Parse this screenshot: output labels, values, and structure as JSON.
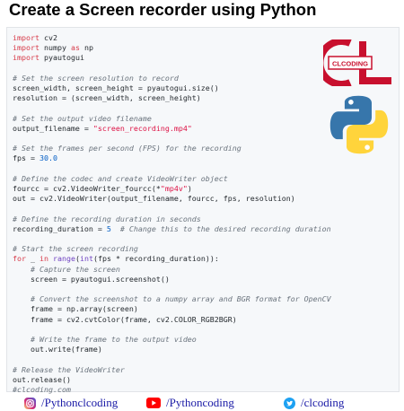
{
  "title": "Create a Screen recorder using Python",
  "logo_text": "CLCODING",
  "colors": {
    "accent_red": "#c8102e",
    "python_blue": "#3776ab",
    "python_yellow": "#ffd43b"
  },
  "code": {
    "l1": [
      "import",
      " cv2"
    ],
    "l2": [
      "import",
      " numpy ",
      "as",
      " np"
    ],
    "l3": [
      "import",
      " pyautogui"
    ],
    "l5": "# Set the screen resolution to record",
    "l6": "screen_width, screen_height = pyautogui.size()",
    "l7": "resolution = (screen_width, screen_height)",
    "l9": "# Set the output video filename",
    "l10a": "output_filename = ",
    "l10b": "\"screen_recording.mp4\"",
    "l12": "# Set the frames per second (FPS) for the recording",
    "l13a": "fps = ",
    "l13b": "30.0",
    "l15": "# Define the codec and create VideoWriter object",
    "l16a": "fourcc = cv2.VideoWriter_fourcc(*",
    "l16b": "\"mp4v\"",
    "l16c": ")",
    "l17": "out = cv2.VideoWriter(output_filename, fourcc, fps, resolution)",
    "l19": "# Define the recording duration in seconds",
    "l20a": "recording_duration = ",
    "l20b": "5",
    "l20c": "  # Change this to the desired recording duration",
    "l22": "# Start the screen recording",
    "l23a": "for",
    "l23b": " _ ",
    "l23c": "in",
    "l23d": " ",
    "l23e": "range",
    "l23f": "(",
    "l23g": "int",
    "l23h": "(fps * recording_duration)):",
    "l24": "    # Capture the screen",
    "l25": "    screen = pyautogui.screenshot()",
    "l27": "    # Convert the screenshot to a numpy array and BGR format for OpenCV",
    "l28": "    frame = np.array(screen)",
    "l29": "    frame = cv2.cvtColor(frame, cv2.COLOR_RGB2BGR)",
    "l31": "    # Write the frame to the output video",
    "l32": "    out.write(frame)",
    "l34": "# Release the VideoWriter",
    "l35": "out.release()",
    "l36": "#clcoding.com"
  },
  "footer": {
    "instagram": "/Pythonclcoding",
    "youtube": "/Pythoncoding",
    "twitter": "/clcoding"
  }
}
